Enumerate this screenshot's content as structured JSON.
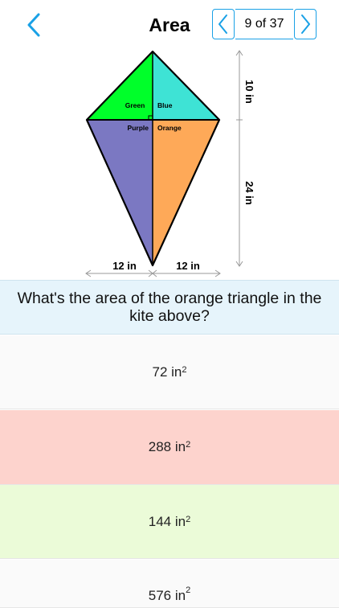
{
  "header": {
    "title": "Area",
    "pager_text": "9 of 37"
  },
  "figure": {
    "labels": {
      "green": "Green",
      "blue": "Blue",
      "purple": "Purple",
      "orange": "Orange",
      "top_height": "10 in",
      "bottom_height": "24 in",
      "left_width": "12 in",
      "right_width": "12 in"
    },
    "colors": {
      "green": "#00ff2a",
      "blue": "#3ee3d5",
      "purple": "#7b78c2",
      "orange": "#fea958"
    }
  },
  "question": {
    "text": "What's the area of the orange triangle in the kite above?"
  },
  "answers": [
    {
      "value": "72 in",
      "exponent": "2"
    },
    {
      "value": "288 in",
      "exponent": "2"
    },
    {
      "value": "144 in",
      "exponent": "2"
    },
    {
      "value": "576 in",
      "exponent": "2"
    }
  ],
  "colors": {
    "accent": "#1aa1e6",
    "question_bg": "#e6f4fb",
    "wrong_bg": "#fdd3cd",
    "correct_bg": "#ebfbd8"
  }
}
